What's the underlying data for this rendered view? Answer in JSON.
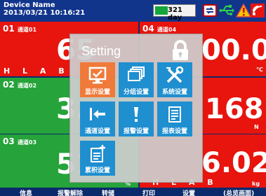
{
  "header": {
    "device_name": "Device Name",
    "datetime": "2013/03/21  10:16:21",
    "days_label": "321 day"
  },
  "channels": [
    {
      "number": "01",
      "name": "通道01",
      "value": "65",
      "color": "#e8140e",
      "hlab": "H L A B"
    },
    {
      "number": "02",
      "name": "通道02",
      "value": "3.",
      "color": "#26a33a"
    },
    {
      "number": "03",
      "name": "通道03",
      "value": "51",
      "color": "#26a33a"
    },
    {
      "number": "04",
      "name": "通道04",
      "value": "00.0",
      "unit": "℃",
      "color": "#e8140e"
    },
    {
      "number": "",
      "name": "",
      "value": "168",
      "unit": "N",
      "color": "#e8140e"
    },
    {
      "number": "",
      "name": "",
      "value": "6.02",
      "unit": "kg",
      "color": "#e8140e",
      "hlab": "H L A B"
    }
  ],
  "partial_unit": "%",
  "bottom_buttons": [
    "信息",
    "报警解除",
    "转储",
    "打印",
    "设置",
    "(总览画面)"
  ],
  "dialog": {
    "title": "Setting",
    "tiles": [
      {
        "label": "显示设置",
        "icon": "display-settings-icon",
        "selected": true
      },
      {
        "label": "分组设置",
        "icon": "group-settings-icon",
        "selected": false
      },
      {
        "label": "系统设置",
        "icon": "system-settings-icon",
        "selected": false
      },
      {
        "label": "通道设置",
        "icon": "channel-settings-icon",
        "selected": false
      },
      {
        "label": "报警设置",
        "icon": "alarm-settings-icon",
        "selected": false
      },
      {
        "label": "报表设置",
        "icon": "report-settings-icon",
        "selected": false
      },
      {
        "label": "累积设置",
        "icon": "accumulate-settings-icon",
        "selected": false
      }
    ]
  },
  "colors": {
    "red": "#e8140e",
    "green": "#26a33a",
    "navy": "#12358c",
    "tile_blue": "#1f8fd0",
    "tile_orange": "#f07a3a"
  }
}
